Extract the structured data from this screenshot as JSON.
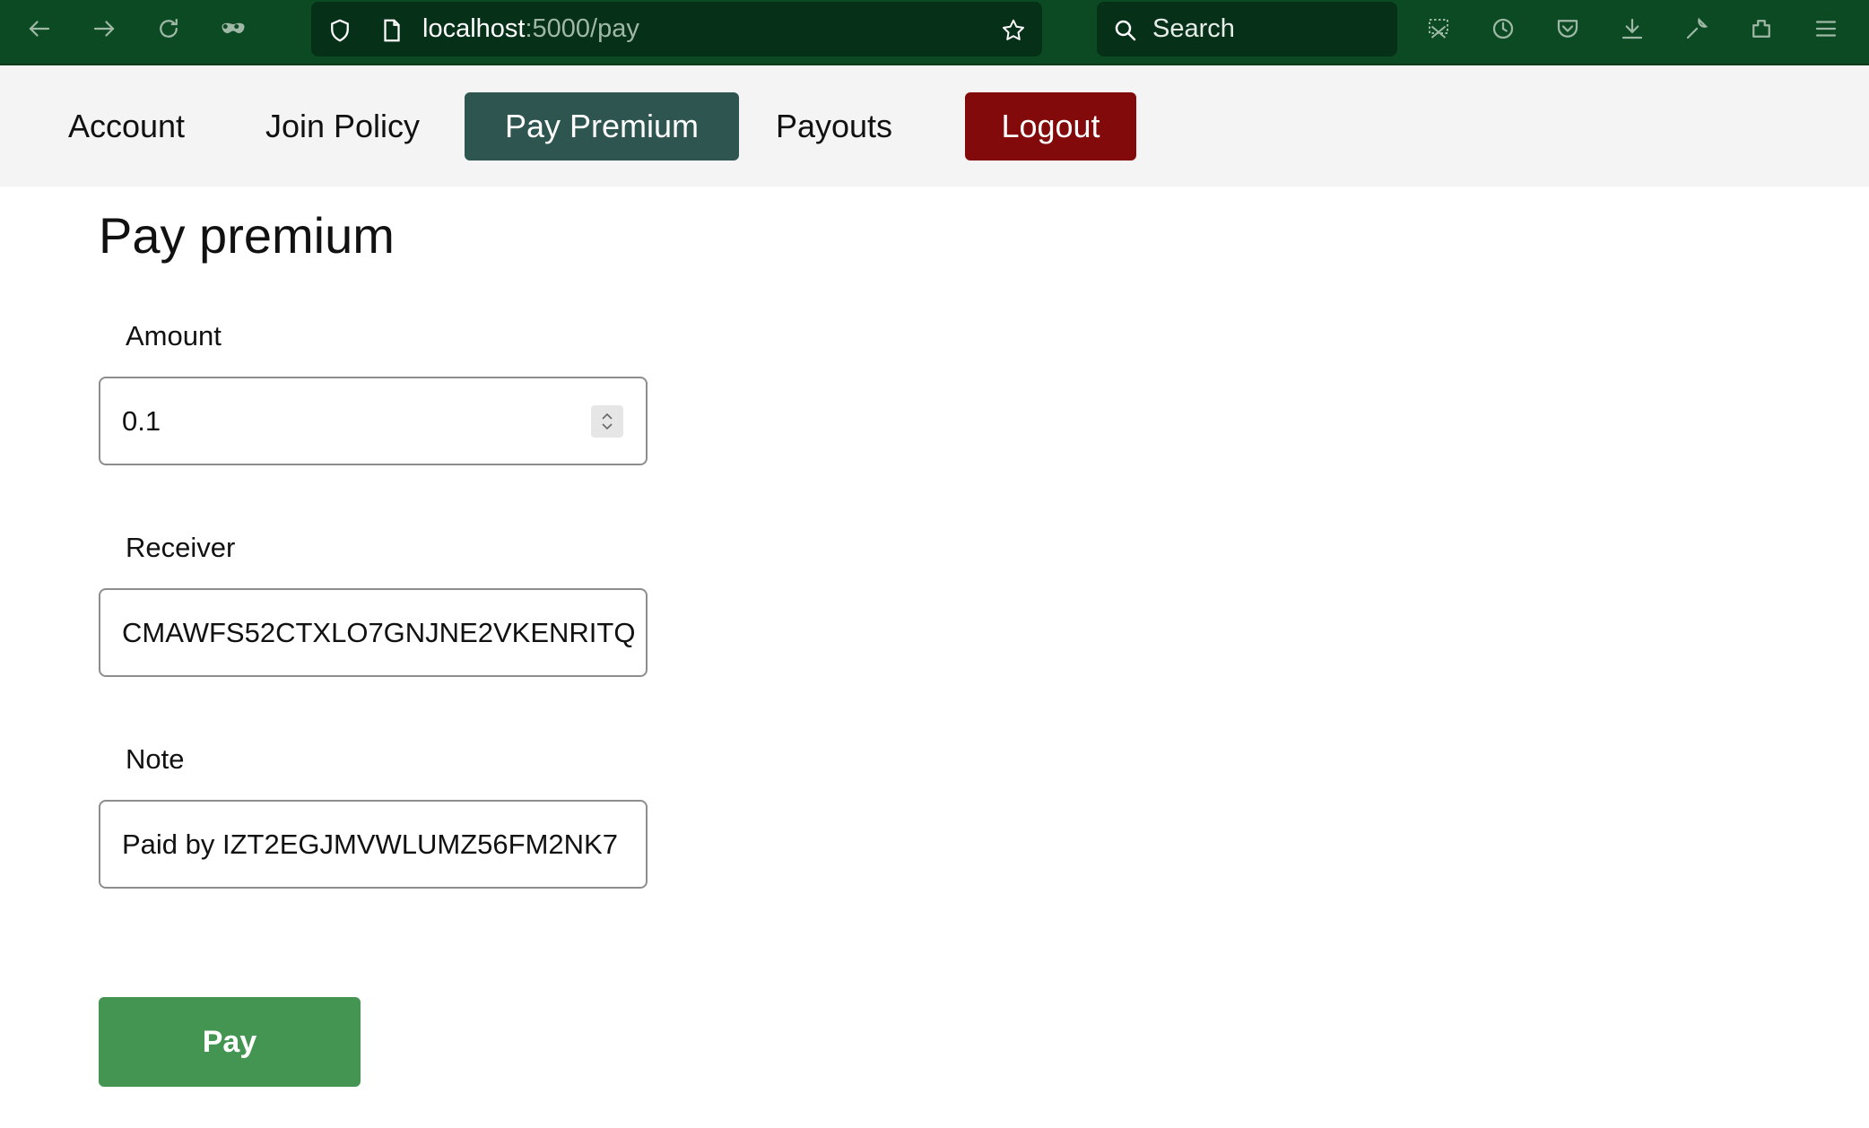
{
  "browser": {
    "url_host": "localhost",
    "url_path": ":5000/pay",
    "search_placeholder": "Search",
    "icons": [
      "back-icon",
      "forward-icon",
      "reload-icon",
      "private-mask-icon",
      "shield-icon",
      "page-icon",
      "bookmark-star-icon",
      "search-icon",
      "screenshot-icon",
      "history-icon",
      "pocket-icon",
      "download-icon",
      "wrench-icon",
      "extensions-icon",
      "menu-icon"
    ]
  },
  "nav": {
    "items": [
      {
        "label": "Account"
      },
      {
        "label": "Join Policy"
      },
      {
        "label": "Pay Premium"
      },
      {
        "label": "Payouts"
      }
    ],
    "logout_label": "Logout",
    "active_color": "#2f5551",
    "logout_color": "#820a0a"
  },
  "form": {
    "title": "Pay premium",
    "amount": {
      "label": "Amount",
      "value": "0.1"
    },
    "receiver": {
      "label": "Receiver",
      "value": "CMAWFS52CTXLO7GNJNE2VKENRITQ"
    },
    "note": {
      "label": "Note",
      "value": "Paid by IZT2EGJMVWLUMZ56FM2NK7"
    },
    "submit_label": "Pay",
    "submit_color": "#449552"
  }
}
